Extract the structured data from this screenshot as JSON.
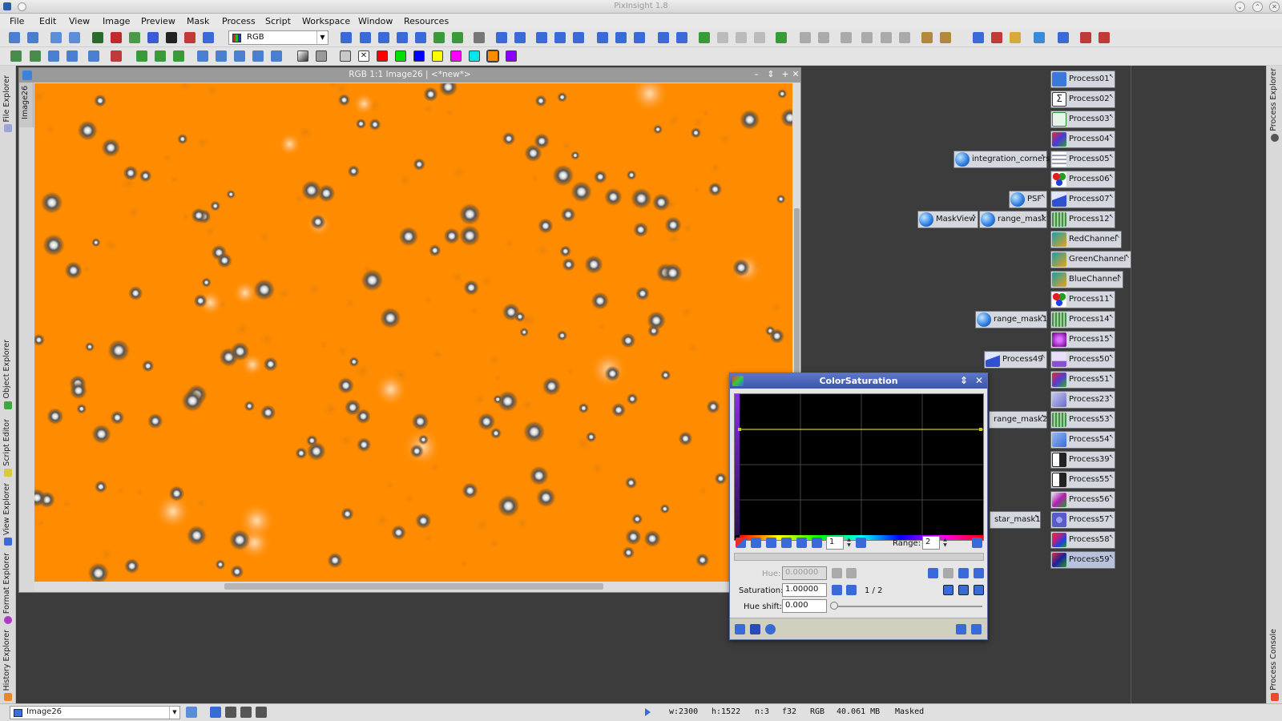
{
  "app": {
    "title": "PixInsight 1.8"
  },
  "menu": [
    "File",
    "Edit",
    "View",
    "Image",
    "Preview",
    "Mask",
    "Process",
    "Script",
    "Workspace",
    "Window",
    "Resources"
  ],
  "toolbar": {
    "colorspace_value": "RGB"
  },
  "left_sidebar": {
    "tabs": [
      "File Explorer",
      "Object Explorer",
      "Script Editor",
      "View Explorer",
      "Format Explorer",
      "History Explorer"
    ]
  },
  "right_sidebar": {
    "tabs": [
      "Process Explorer",
      "Process Console"
    ]
  },
  "image_window": {
    "title": "RGB 1:1 Image26 | <*new*>",
    "tab_label": "Image26",
    "background_color": "#ff8c00",
    "scroll": {
      "vertical_position": 0.5,
      "horizontal_position": 0.5
    }
  },
  "process_icons": [
    {
      "label": "Process01",
      "icon": "stf-icon",
      "color": "#3b78d8"
    },
    {
      "label": "Process02",
      "icon": "sigma-icon",
      "color": "#ffffff"
    },
    {
      "label": "Process03",
      "icon": "crop-icon",
      "color": "#2e8b3a"
    },
    {
      "label": "Process04",
      "icon": "image-icon",
      "color": "#4a3ad8"
    },
    {
      "label": "Process05",
      "icon": "table-icon",
      "color": "#9aa0b8"
    },
    {
      "label": "Process06",
      "icon": "color-dots-icon",
      "color": "#e02020"
    },
    {
      "label": "Process07",
      "icon": "curve-icon",
      "color": "#3050d0"
    },
    {
      "label": "Process12",
      "icon": "bars-icon",
      "color": "#4a8a4a"
    },
    {
      "label": "RedChannel",
      "icon": "channel-icon",
      "color": "#18a0a8"
    },
    {
      "label": "GreenChannel",
      "icon": "channel-icon",
      "color": "#18a0a8"
    },
    {
      "label": "BlueChannel",
      "icon": "channel-icon",
      "color": "#18a0a8"
    },
    {
      "label": "Process11",
      "icon": "color-dots-icon",
      "color": "#e02020"
    },
    {
      "label": "Process14",
      "icon": "bars-icon",
      "color": "#4a8a4a"
    },
    {
      "label": "Process15",
      "icon": "stars-icon",
      "color": "#a030c0"
    },
    {
      "label": "Process50",
      "icon": "histogram-icon",
      "color": "#8a50d0"
    },
    {
      "label": "Process51",
      "icon": "curves-icon",
      "color": "#5a3ad0"
    },
    {
      "label": "Process23",
      "icon": "gradient-icon",
      "color": "#6a6ac8"
    },
    {
      "label": "Process53",
      "icon": "bars-icon",
      "color": "#4a8a4a"
    },
    {
      "label": "Process54",
      "icon": "arrows-icon",
      "color": "#3a6ad8"
    },
    {
      "label": "Process39",
      "icon": "contrast-icon",
      "color": "#222222"
    },
    {
      "label": "Process55",
      "icon": "contrast-icon",
      "color": "#222222"
    },
    {
      "label": "Process56",
      "icon": "rgb-curves-icon",
      "color": "#b020b0"
    },
    {
      "label": "Process57",
      "icon": "dots-grid-icon",
      "color": "#5a5ac8"
    },
    {
      "label": "Process58",
      "icon": "rainbow-icon",
      "color": "#c02080"
    },
    {
      "label": "Process59",
      "icon": "rgb-curves-icon",
      "color": "#2020a0"
    }
  ],
  "script_icons": [
    {
      "label": "integration_corners",
      "icon": "sphere-icon"
    },
    {
      "label": "PSF",
      "icon": "sphere-icon"
    },
    {
      "label": "MaskView",
      "icon": "sphere-icon"
    },
    {
      "label": "range_mask",
      "icon": "sphere-icon"
    },
    {
      "label": "range_mask1",
      "icon": "sphere-icon"
    },
    {
      "label": "Process49",
      "icon": "curve-icon"
    },
    {
      "label": "range_mask2",
      "icon": "none"
    },
    {
      "label": "star_mask1",
      "icon": "none"
    }
  ],
  "color_saturation": {
    "title": "ColorSaturation",
    "zoom_value": "1",
    "range_label": "Range:",
    "range_value": "2",
    "hue_label": "Hue:",
    "hue_value": "0.00000",
    "saturation_label": "Saturation:",
    "saturation_value": "1.00000",
    "point_index": "1 / 2",
    "hue_shift_label": "Hue shift:",
    "hue_shift_value": "0.000",
    "curve_color": "#c8c820"
  },
  "status": {
    "view_value": "Image26",
    "width": "w:2300",
    "height": "h:1522",
    "channels": "n:3",
    "sample_format": "f32",
    "color_space": "RGB",
    "size": "40.061 MB",
    "mask_state": "Masked"
  }
}
